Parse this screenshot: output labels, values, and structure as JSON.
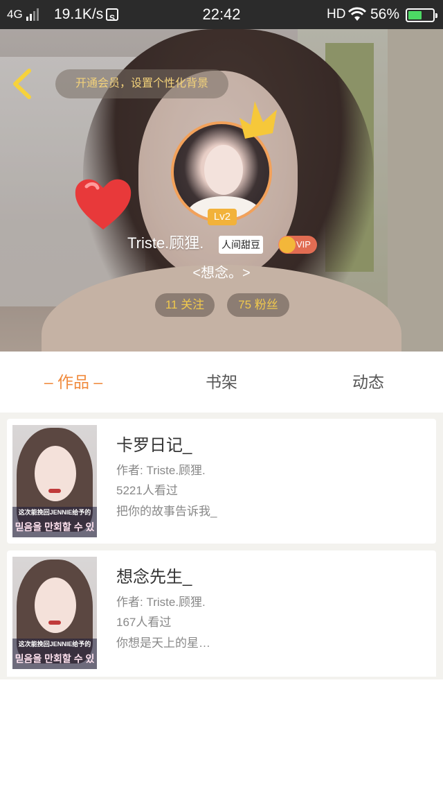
{
  "status_bar": {
    "network": "4G",
    "speed": "19.1K/s",
    "speed_icon": "S",
    "time": "22:42",
    "hd": "HD",
    "battery_percent": "56%",
    "battery_level": 0.56,
    "colors": {
      "background": "#2b2b2b",
      "battery": "#4cd964"
    }
  },
  "header": {
    "back_icon": "chevron-left-icon",
    "vip_banner": "开通会员，设置个性化背景",
    "level": "Lv2",
    "username": "Triste.顾狸.",
    "tag": "人间甜豆",
    "vip_label": "VIP",
    "signature": "<想念。>",
    "following": "11 关注",
    "fans": "75 粉丝"
  },
  "tabs": [
    {
      "label": "– 作品 –",
      "active": true
    },
    {
      "label": "书架",
      "active": false
    },
    {
      "label": "动态",
      "active": false
    }
  ],
  "works": [
    {
      "title": "卡罗日记_",
      "author": "作者: Triste.顾狸.",
      "views": "5221人看过",
      "intro": "把你的故事告诉我_",
      "cover_caption": "这次能挽回JENNIE给予的",
      "cover_caption_2": "믿음을 만회할 수 있"
    },
    {
      "title": "想念先生_",
      "author": "作者: Triste.顾狸.",
      "views": "167人看过",
      "intro": "你想是天上的星…",
      "cover_caption": "这次能挽回JENNIE给予的",
      "cover_caption_2": "믿음을 만회할 수 있"
    }
  ],
  "colors": {
    "accent": "#f08a3c",
    "gold": "#f0c94d",
    "level_badge": "#f2b23a"
  }
}
